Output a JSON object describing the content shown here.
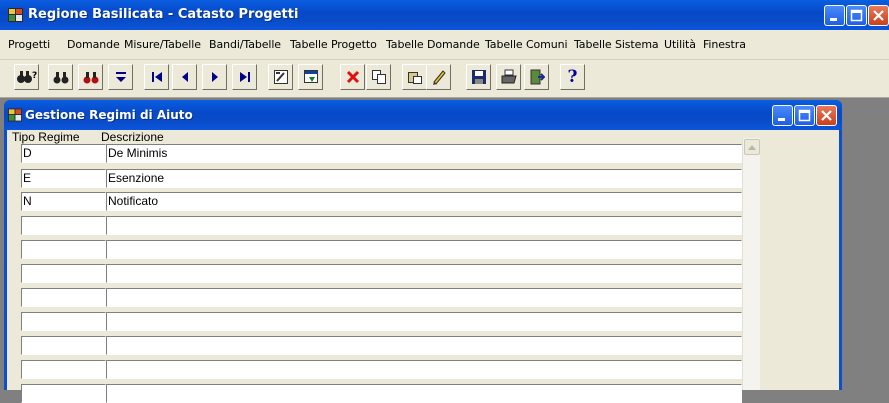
{
  "app": {
    "title": "Regione Basilicata - Catasto Progetti"
  },
  "menu": [
    "Progetti",
    "Domande",
    "Misure/Tabelle",
    "Bandi/Tabelle",
    "Tabelle Progetto",
    "Tabelle Domande",
    "Tabelle Comuni",
    "Tabelle Sistema",
    "Utilità",
    "Finestra"
  ],
  "toolbar": {
    "icons": [
      "find-query-icon",
      "find-icon",
      "find-red-icon",
      "sort-icon",
      "first-record-icon",
      "prev-record-icon",
      "next-record-icon",
      "last-record-icon",
      "edit-form-icon",
      "filter-icon",
      "delete-icon",
      "copy-icon",
      "paste-edit-icon",
      "save-icon",
      "print-icon",
      "exit-icon",
      "help-icon"
    ],
    "help_label": "?"
  },
  "child_window": {
    "title": "Gestione Regimi di Aiuto"
  },
  "table": {
    "columns": [
      "Tipo Regime",
      "Descrizione"
    ],
    "rows": [
      {
        "tipo": "D",
        "descrizione": "De Minimis"
      },
      {
        "tipo": "E",
        "descrizione": "Esenzione"
      },
      {
        "tipo": "N",
        "descrizione": "Notificato"
      },
      {
        "tipo": "",
        "descrizione": ""
      },
      {
        "tipo": "",
        "descrizione": ""
      },
      {
        "tipo": "",
        "descrizione": ""
      },
      {
        "tipo": "",
        "descrizione": ""
      },
      {
        "tipo": "",
        "descrizione": ""
      },
      {
        "tipo": "",
        "descrizione": ""
      },
      {
        "tipo": "",
        "descrizione": ""
      },
      {
        "tipo": "",
        "descrizione": ""
      }
    ]
  }
}
